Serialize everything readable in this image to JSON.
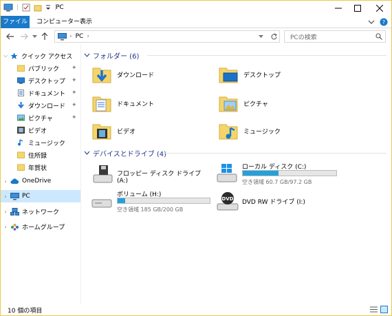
{
  "window": {
    "title": "PC"
  },
  "ribbon": {
    "tabs": [
      "ファイル",
      "コンピューター",
      "表示"
    ]
  },
  "address": {
    "path": "PC",
    "search_placeholder": "PCの検索"
  },
  "nav": {
    "quick_access": "クイック アクセス",
    "items": [
      "パブリック",
      "デスクトップ",
      "ドキュメント",
      "ダウンロード",
      "ピクチャ",
      "ビデオ",
      "ミュージック",
      "住所録",
      "年賀状"
    ],
    "onedrive": "OneDrive",
    "pc": "PC",
    "network": "ネットワーク",
    "homegroup": "ホームグループ"
  },
  "folders": {
    "header": "フォルダー (6)",
    "items": [
      "ダウンロード",
      "デスクトップ",
      "ドキュメント",
      "ピクチャ",
      "ビデオ",
      "ミュージック"
    ]
  },
  "drives": {
    "header": "デバイスとドライブ (4)",
    "floppy": {
      "name": "フロッピー ディスク ドライブ (A:)"
    },
    "local": {
      "name": "ローカル ディスク (C:)",
      "free": "空き領域 60.7 GB/97.2 GB",
      "used_fraction": 0.38
    },
    "volume": {
      "name": "ボリューム (H:)",
      "free": "空き領域 185 GB/200 GB",
      "used_fraction": 0.08
    },
    "dvd": {
      "name": "DVD RW ドライブ (I:)"
    }
  },
  "status": {
    "count": "10 個の項目"
  },
  "colors": {
    "accent": "#1979ca",
    "selection": "#cce8ff",
    "bar_fill": "#26a0da",
    "group_header": "#1e3287"
  }
}
